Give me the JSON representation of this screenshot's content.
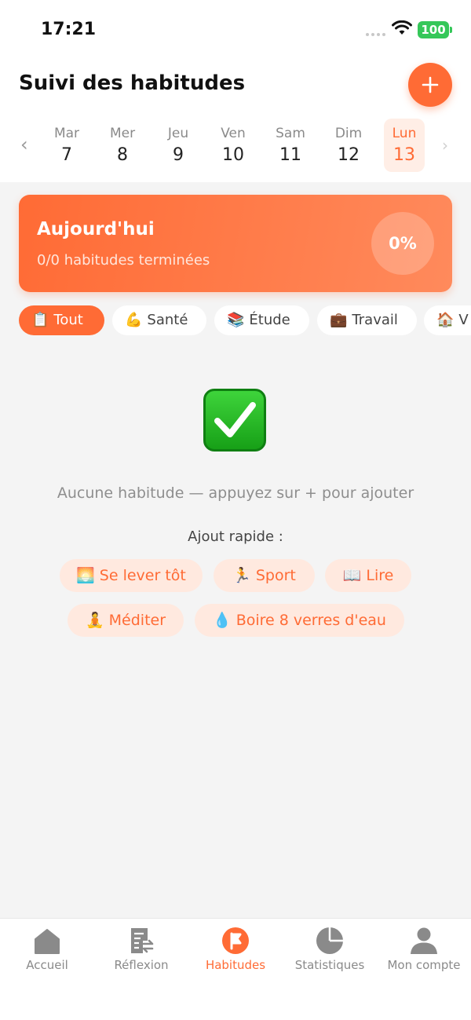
{
  "status": {
    "time": "17:21",
    "battery": "100"
  },
  "header": {
    "title": "Suivi des habitudes"
  },
  "calendar": {
    "days": [
      {
        "name": "Mar",
        "num": "7"
      },
      {
        "name": "Mer",
        "num": "8"
      },
      {
        "name": "Jeu",
        "num": "9"
      },
      {
        "name": "Ven",
        "num": "10"
      },
      {
        "name": "Sam",
        "num": "11"
      },
      {
        "name": "Dim",
        "num": "12"
      },
      {
        "name": "Lun",
        "num": "13"
      }
    ],
    "selected_index": 6
  },
  "today": {
    "title": "Aujourd'hui",
    "subtitle": "0/0 habitudes terminées",
    "percent": "0%"
  },
  "categories": [
    {
      "emoji": "📋",
      "label": "Tout",
      "active": true
    },
    {
      "emoji": "💪",
      "label": "Santé"
    },
    {
      "emoji": "📚",
      "label": "Étude"
    },
    {
      "emoji": "💼",
      "label": "Travail"
    },
    {
      "emoji": "🏠",
      "label": "V"
    }
  ],
  "empty": {
    "message": "Aucune habitude — appuyez sur + pour ajouter",
    "quick_label": "Ajout rapide :"
  },
  "quick_add": [
    {
      "emoji": "🌅",
      "label": "Se lever tôt"
    },
    {
      "emoji": "🏃",
      "label": "Sport"
    },
    {
      "emoji": "📖",
      "label": "Lire"
    },
    {
      "emoji": "🧘",
      "label": "Méditer"
    },
    {
      "emoji": "💧",
      "label": "Boire 8 verres d'eau"
    }
  ],
  "tabs": [
    {
      "label": "Accueil",
      "icon": "home-icon"
    },
    {
      "label": "Réflexion",
      "icon": "reflection-icon"
    },
    {
      "label": "Habitudes",
      "icon": "habits-flag-icon",
      "active": true
    },
    {
      "label": "Statistiques",
      "icon": "pie-chart-icon"
    },
    {
      "label": "Mon compte",
      "icon": "user-icon"
    }
  ],
  "colors": {
    "accent": "#ff6b35",
    "accent_light": "#ffe9df",
    "inactive": "#8a8a8a"
  }
}
